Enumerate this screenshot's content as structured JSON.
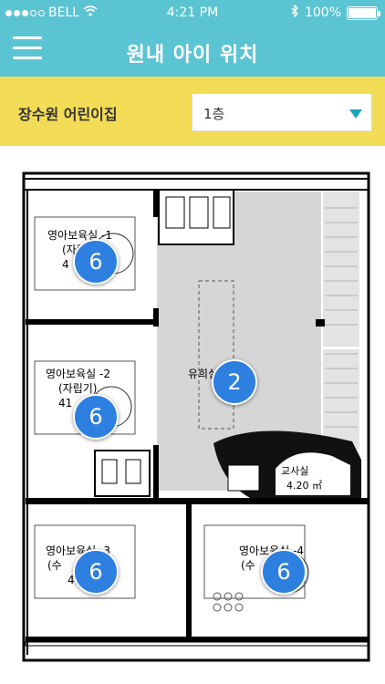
{
  "status_bar": {
    "carrier": "BELL",
    "time": "4:21 PM",
    "battery": "100%",
    "battery_level": 1.0,
    "signal_dots_filled": 3,
    "signal_dots_total": 5
  },
  "header": {
    "title": "원내 아이 위치",
    "menu_icon": "hamburger-icon"
  },
  "filter": {
    "school_name": "장수원 어린이집",
    "floor_selected": "1층"
  },
  "floor_plan": {
    "rooms": [
      {
        "id": "infant-1",
        "name": "영아보육실 -1",
        "sub": "(자립기)",
        "area": "4",
        "count": "6"
      },
      {
        "id": "infant-2",
        "name": "영아보육실 -2",
        "sub": "(자립기)",
        "area": "41",
        "count": "6"
      },
      {
        "id": "play",
        "name": "유희실/목적실",
        "count": "2"
      },
      {
        "id": "teacher",
        "name": "교사실",
        "area": "4.20 ㎡"
      },
      {
        "id": "infant-3",
        "name": "영아보육실 -3",
        "sub": "(수",
        "area": "4",
        "count": "6"
      },
      {
        "id": "infant-4",
        "name": "영아보육실 -4",
        "sub": "(수",
        "count": "6"
      }
    ]
  },
  "colors": {
    "header_bg": "#5bc4d2",
    "filter_bg": "#f3dc55",
    "badge_bg": "#2d7fe0",
    "caret": "#19a5b8"
  }
}
